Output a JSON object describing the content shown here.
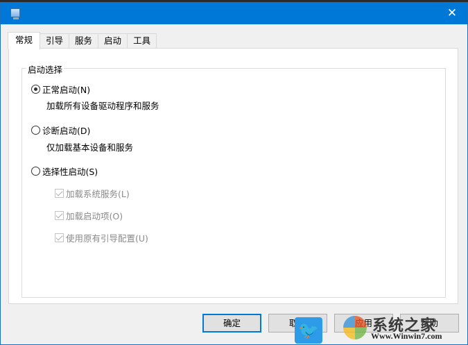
{
  "titlebar": {
    "close_icon": "✕"
  },
  "tabs": [
    {
      "label": "常规",
      "active": true
    },
    {
      "label": "引导"
    },
    {
      "label": "服务"
    },
    {
      "label": "启动"
    },
    {
      "label": "工具"
    }
  ],
  "group": {
    "legend": "启动选择",
    "normal": {
      "label": "正常启动(N)",
      "desc": "加载所有设备驱动程序和服务",
      "selected": true
    },
    "diagnostic": {
      "label": "诊断启动(D)",
      "desc": "仅加载基本设备和服务",
      "selected": false
    },
    "selective": {
      "label": "选择性启动(S)",
      "selected": false
    },
    "checkboxes": [
      {
        "label": "加载系统服务(L)",
        "checked": true,
        "disabled": true
      },
      {
        "label": "加载启动项(O)",
        "checked": true,
        "disabled": true
      },
      {
        "label": "使用原有引导配置(U)",
        "checked": true,
        "disabled": true
      }
    ]
  },
  "buttons": {
    "ok": "确定",
    "cancel": "取消",
    "apply": "应用",
    "help": "帮助"
  },
  "watermark": {
    "brand": "系统之家",
    "url": "Www.Winwin7.com"
  }
}
